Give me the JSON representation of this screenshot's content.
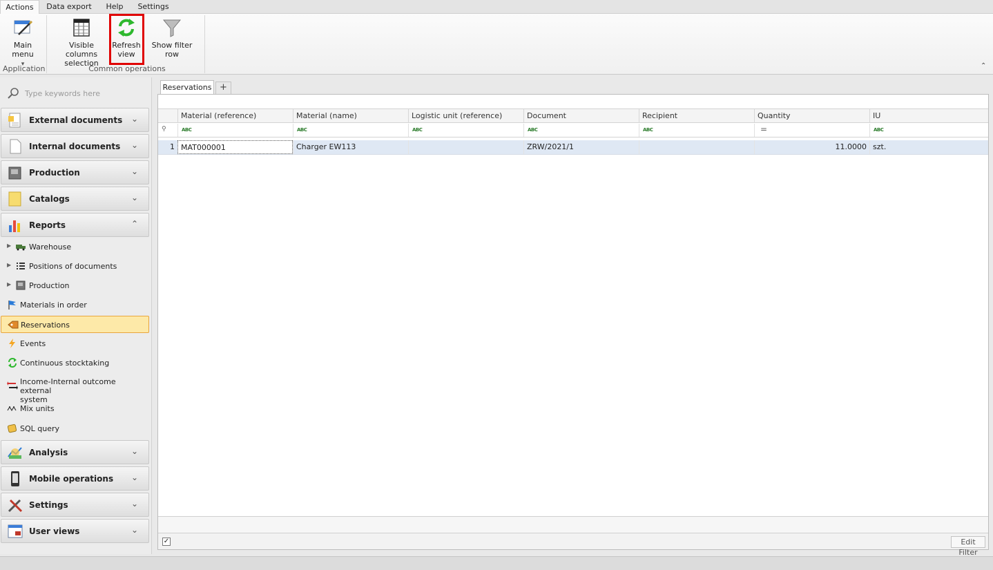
{
  "menu": {
    "tabs": [
      {
        "label": "Actions",
        "active": true
      },
      {
        "label": "Data export",
        "active": false
      },
      {
        "label": "Help",
        "active": false
      },
      {
        "label": "Settings",
        "active": false
      }
    ]
  },
  "ribbon": {
    "main_menu": {
      "line1": "Main menu",
      "dropdown": "▾",
      "icon": "main-menu-icon"
    },
    "visible_columns": {
      "line1": "Visible columns",
      "line2": "selection",
      "icon": "table-columns-icon"
    },
    "refresh": {
      "line1": "Refresh",
      "line2": "view",
      "icon": "refresh-icon"
    },
    "filter_row": {
      "line1": "Show filter row",
      "icon": "funnel-icon"
    },
    "group_application": "Application",
    "group_common": "Common operations",
    "collapse_glyph": "⌃"
  },
  "nav": {
    "search_placeholder": "Type keywords here",
    "groups_top": [
      {
        "label": "External documents",
        "icon": "external-documents-icon",
        "expanded": false
      },
      {
        "label": "Internal documents",
        "icon": "internal-documents-icon",
        "expanded": false
      },
      {
        "label": "Production",
        "icon": "production-icon",
        "expanded": false
      },
      {
        "label": "Catalogs",
        "icon": "catalogs-icon",
        "expanded": false
      },
      {
        "label": "Reports",
        "icon": "reports-icon",
        "expanded": true
      }
    ],
    "report_items": [
      {
        "label": "Warehouse",
        "icon": "truck-icon",
        "has_children": true
      },
      {
        "label": "Positions of documents",
        "icon": "list-icon",
        "has_children": true
      },
      {
        "label": "Production",
        "icon": "machine-icon",
        "has_children": true
      },
      {
        "label": "Materials in order",
        "icon": "flag-icon",
        "has_children": false
      },
      {
        "label": "Reservations",
        "icon": "reservation-tag-icon",
        "has_children": false,
        "selected": true
      },
      {
        "label": "Events",
        "icon": "lightning-icon",
        "has_children": false
      },
      {
        "label": "Continuous stocktaking",
        "icon": "cycle-icon",
        "has_children": false
      },
      {
        "label": "Income-Internal outcome external",
        "label2": "system",
        "icon": "exchange-arrows-icon",
        "has_children": false
      },
      {
        "label": "Mix units",
        "icon": "mix-units-icon",
        "has_children": false
      },
      {
        "label": "SQL query",
        "icon": "sql-query-icon",
        "has_children": false
      }
    ],
    "groups_bottom": [
      {
        "label": "Analysis",
        "icon": "analysis-icon",
        "expanded": false
      },
      {
        "label": "Mobile operations",
        "icon": "mobile-icon",
        "expanded": false
      },
      {
        "label": "Settings",
        "icon": "tools-icon",
        "expanded": false
      },
      {
        "label": "User views",
        "icon": "user-views-icon",
        "expanded": false
      }
    ],
    "chevron_down": "⌄",
    "chevron_up": "⌃"
  },
  "doc_tabs": {
    "active": "Reservations",
    "add_label": "+"
  },
  "grid": {
    "columns": [
      "Material (reference)",
      "Material (name)",
      "Logistic unit (reference)",
      "Document",
      "Recipient",
      "Quantity",
      "IU"
    ],
    "filter_glyphs": [
      "ABC",
      "ABC",
      "ABC",
      "ABC",
      "ABC",
      "=",
      "ABC"
    ],
    "rows": [
      {
        "num": "1",
        "material_ref": "MAT000001",
        "material_name": "Charger EW113",
        "logistic_unit": "",
        "document": "ZRW/2021/1",
        "recipient": "",
        "quantity": "11.0000",
        "iu": "szt."
      }
    ],
    "filter_enabled_glyph": "✓",
    "edit_filter_label": "Edit Filter"
  }
}
